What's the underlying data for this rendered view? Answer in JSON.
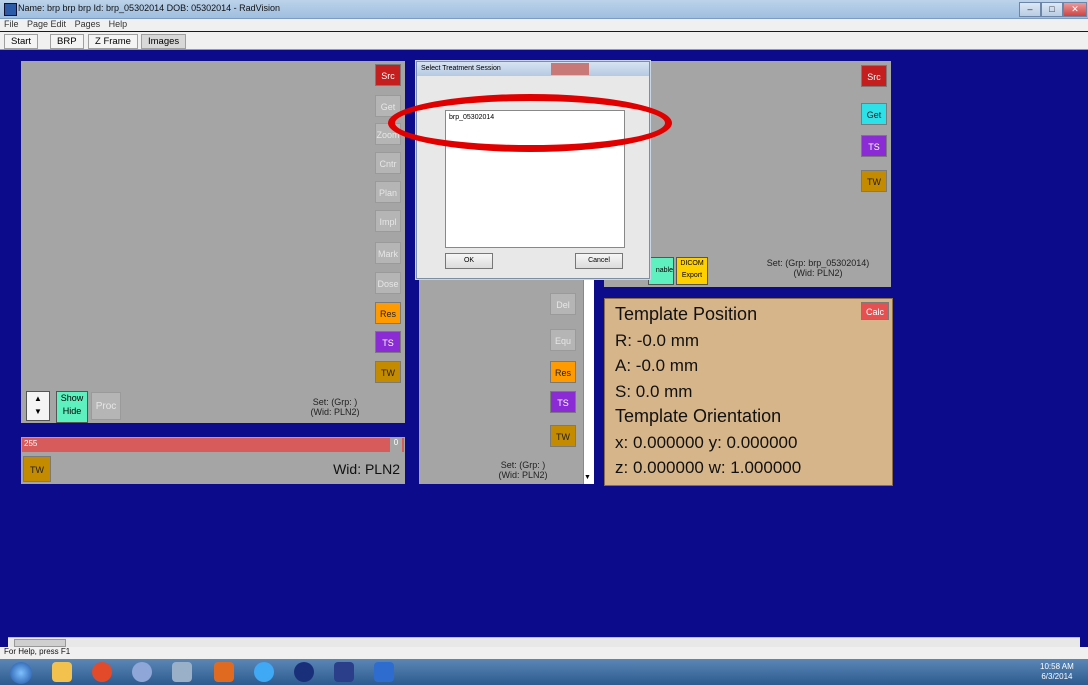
{
  "window": {
    "title": "Name: brp brp brp   Id: brp_05302014   DOB: 05302014 - RadVision",
    "controls": [
      "–",
      "□",
      "✕"
    ]
  },
  "menu": [
    "File",
    "Page Edit",
    "Pages",
    "Help"
  ],
  "tabs": [
    "Start",
    "BRP",
    "Z Frame",
    "Images"
  ],
  "left_panel": {
    "buttons": [
      "Src",
      "Get",
      "Zoom",
      "Cntr",
      "Plan",
      "Impl",
      "Mark",
      "Dose",
      "Res",
      "TS",
      "TW"
    ],
    "show_label": "Show",
    "hide_label": "Hide",
    "proc_label": "Proc",
    "set_line1": "Set: (Grp: )",
    "set_line2": "(Wid: PLN2)",
    "range_min": "255",
    "range_max": "0",
    "tw_label": "TW",
    "wid_label": "Wid: PLN2"
  },
  "middle_panel": {
    "buttons": [
      "Del",
      "Equ",
      "Res",
      "TS",
      "TW"
    ],
    "set_line1": "Set: (Grp: )",
    "set_line2": "(Wid: PLN2)"
  },
  "right_panel": {
    "buttons": [
      "Src",
      "Get",
      "TS",
      "TW"
    ],
    "enable_label": "nable",
    "dicom_label_1": "DICOM",
    "dicom_label_2": "Export",
    "set_line1": "Set: (Grp: brp_05302014)",
    "set_line2": "(Wid: PLN2)"
  },
  "template": {
    "title": "Template Position",
    "calc": "Calc",
    "r": "R: -0.0  mm",
    "a": "A: -0.0  mm",
    "s": "S: 0.0  mm",
    "orient_title": "Template Orientation",
    "xy": "x: 0.000000  y: 0.000000",
    "zw": "z: 0.000000  w: 1.000000"
  },
  "dialog": {
    "title": "Select Treatment Session",
    "item": "brp_05302014",
    "ok": "OK",
    "cancel": "Cancel"
  },
  "status": {
    "help": "For Help, press F1"
  },
  "taskbar": {
    "time": "10:58 AM",
    "date": "6/3/2014"
  }
}
